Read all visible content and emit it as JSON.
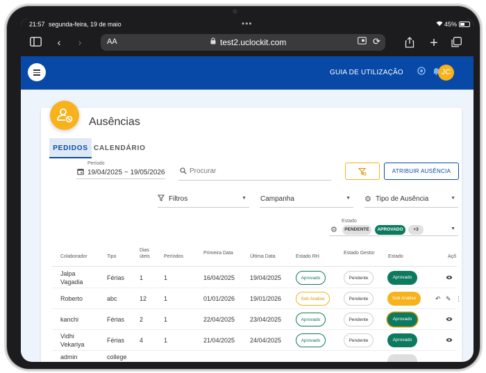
{
  "status_bar": {
    "time": "21:57",
    "date": "segunda-feira, 19 de maio",
    "battery": "45%"
  },
  "browser": {
    "aa_label": "AA",
    "url": "test2.uclockit.com"
  },
  "header": {
    "guide_label": "GUIA DE UTILIZAÇÃO",
    "avatar_initials": "JC"
  },
  "page": {
    "title": "Ausências",
    "tabs": [
      {
        "label": "PEDIDOS",
        "active": true
      },
      {
        "label": "CALENDÁRIO",
        "active": false
      }
    ]
  },
  "filters": {
    "period_label": "Período",
    "period_value": "19/04/2025 ~ 19/05/2026",
    "search_placeholder": "Procurar",
    "assign_button": "ATRIBUIR AUSÊNCIA",
    "filtros": "Filtros",
    "campanha": "Campanha",
    "tipo_ausencia": "Tipo de Ausência",
    "estado_label": "Estado",
    "estado_chips": [
      "PENDENTE",
      "APROVADO",
      "+3"
    ]
  },
  "table": {
    "headers": {
      "colaborador": "Colaborador",
      "tipo": "Tipo",
      "dias_1": "Dias",
      "dias_2": "úteis",
      "periodos": "Períodos",
      "primeira": "Primeira Data",
      "ultima": "Última Data",
      "estado_rh": "Estado RH",
      "estado_gestor": "Estado Gestor",
      "estado": "Estado",
      "acoes": "Açõ"
    },
    "rows": [
      {
        "colaborador": [
          "Jalpa",
          "Vagadia"
        ],
        "tipo": "Férias",
        "dias": "1",
        "periodos": "1",
        "primeira": "16/04/2025",
        "ultima": "19/04/2025",
        "estado_rh": "Aprovado",
        "estado_gestor": "Pendente",
        "estado": "Aprovado"
      },
      {
        "colaborador": [
          "Roberto"
        ],
        "tipo": "abc",
        "dias": "12",
        "periodos": "1",
        "primeira": "01/01/2026",
        "ultima": "19/01/2026",
        "estado_rh": "Sob Análise",
        "estado_gestor": "Pendente",
        "estado": "Sob Análise"
      },
      {
        "colaborador": [
          "kanchi"
        ],
        "tipo": "Férias",
        "dias": "2",
        "periodos": "1",
        "primeira": "22/04/2025",
        "ultima": "23/04/2025",
        "estado_rh": "Aprovado",
        "estado_gestor": "Pendente",
        "estado": "Aprovado"
      },
      {
        "colaborador": [
          "Vidhi",
          "Vekariya"
        ],
        "tipo": "Férias",
        "dias": "4",
        "periodos": "1",
        "primeira": "21/04/2025",
        "ultima": "24/04/2025",
        "estado_rh": "Aprovado",
        "estado_gestor": "Pendente",
        "estado": "Aprovado"
      },
      {
        "colaborador": [
          "admin"
        ],
        "tipo": "college"
      }
    ]
  },
  "colors": {
    "brand_blue": "#0848a6",
    "accent_yellow": "#f7b21c",
    "approved_green": "#0c7a5e"
  }
}
